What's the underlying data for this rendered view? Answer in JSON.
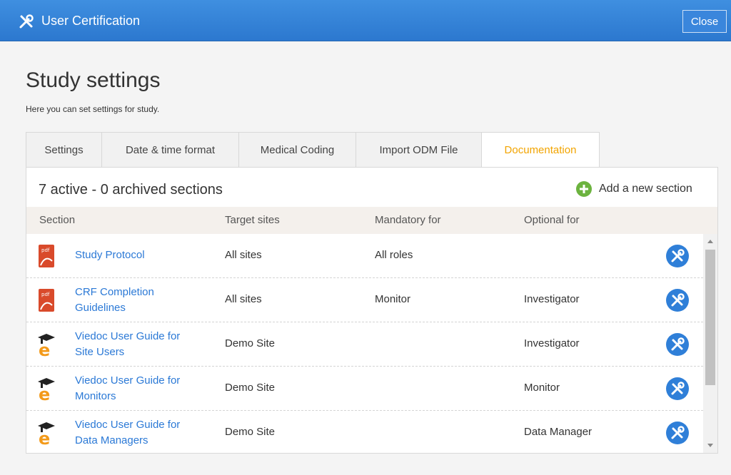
{
  "window": {
    "title": "User Certification",
    "close_label": "Close"
  },
  "page": {
    "title": "Study settings",
    "subtitle": "Here you can set settings for study."
  },
  "tabs": [
    {
      "label": "Settings",
      "active": false
    },
    {
      "label": "Date & time format",
      "active": false
    },
    {
      "label": "Medical Coding",
      "active": false
    },
    {
      "label": "Import ODM File",
      "active": false
    },
    {
      "label": "Documentation",
      "active": true
    }
  ],
  "panel": {
    "count_text": "7 active - 0 archived sections",
    "add_label": "Add a new section"
  },
  "table": {
    "headers": [
      "Section",
      "Target sites",
      "Mandatory for",
      "Optional for"
    ],
    "rows": [
      {
        "icon": "pdf-icon",
        "name_lines": [
          "Study Protocol"
        ],
        "target": "All sites",
        "mandatory": "All roles",
        "optional": ""
      },
      {
        "icon": "pdf-icon",
        "name_lines": [
          "CRF Completion",
          "Guidelines"
        ],
        "target": "All sites",
        "mandatory": "Monitor",
        "optional": "Investigator"
      },
      {
        "icon": "elearning-icon",
        "name_lines": [
          "Viedoc User Guide for",
          "Site Users"
        ],
        "target": "Demo Site",
        "mandatory": "",
        "optional": "Investigator"
      },
      {
        "icon": "elearning-icon",
        "name_lines": [
          "Viedoc User Guide for",
          "Monitors"
        ],
        "target": "Demo Site",
        "mandatory": "",
        "optional": "Monitor"
      },
      {
        "icon": "elearning-icon",
        "name_lines": [
          "Viedoc User Guide for",
          "Data Managers"
        ],
        "target": "Demo Site",
        "mandatory": "",
        "optional": "Data Manager"
      }
    ]
  },
  "colors": {
    "header_blue": "#2c78cf",
    "link_blue": "#2b79d6",
    "active_tab": "#f2a400",
    "add_green": "#6cb33f",
    "action_blue": "#2f7fd8"
  }
}
